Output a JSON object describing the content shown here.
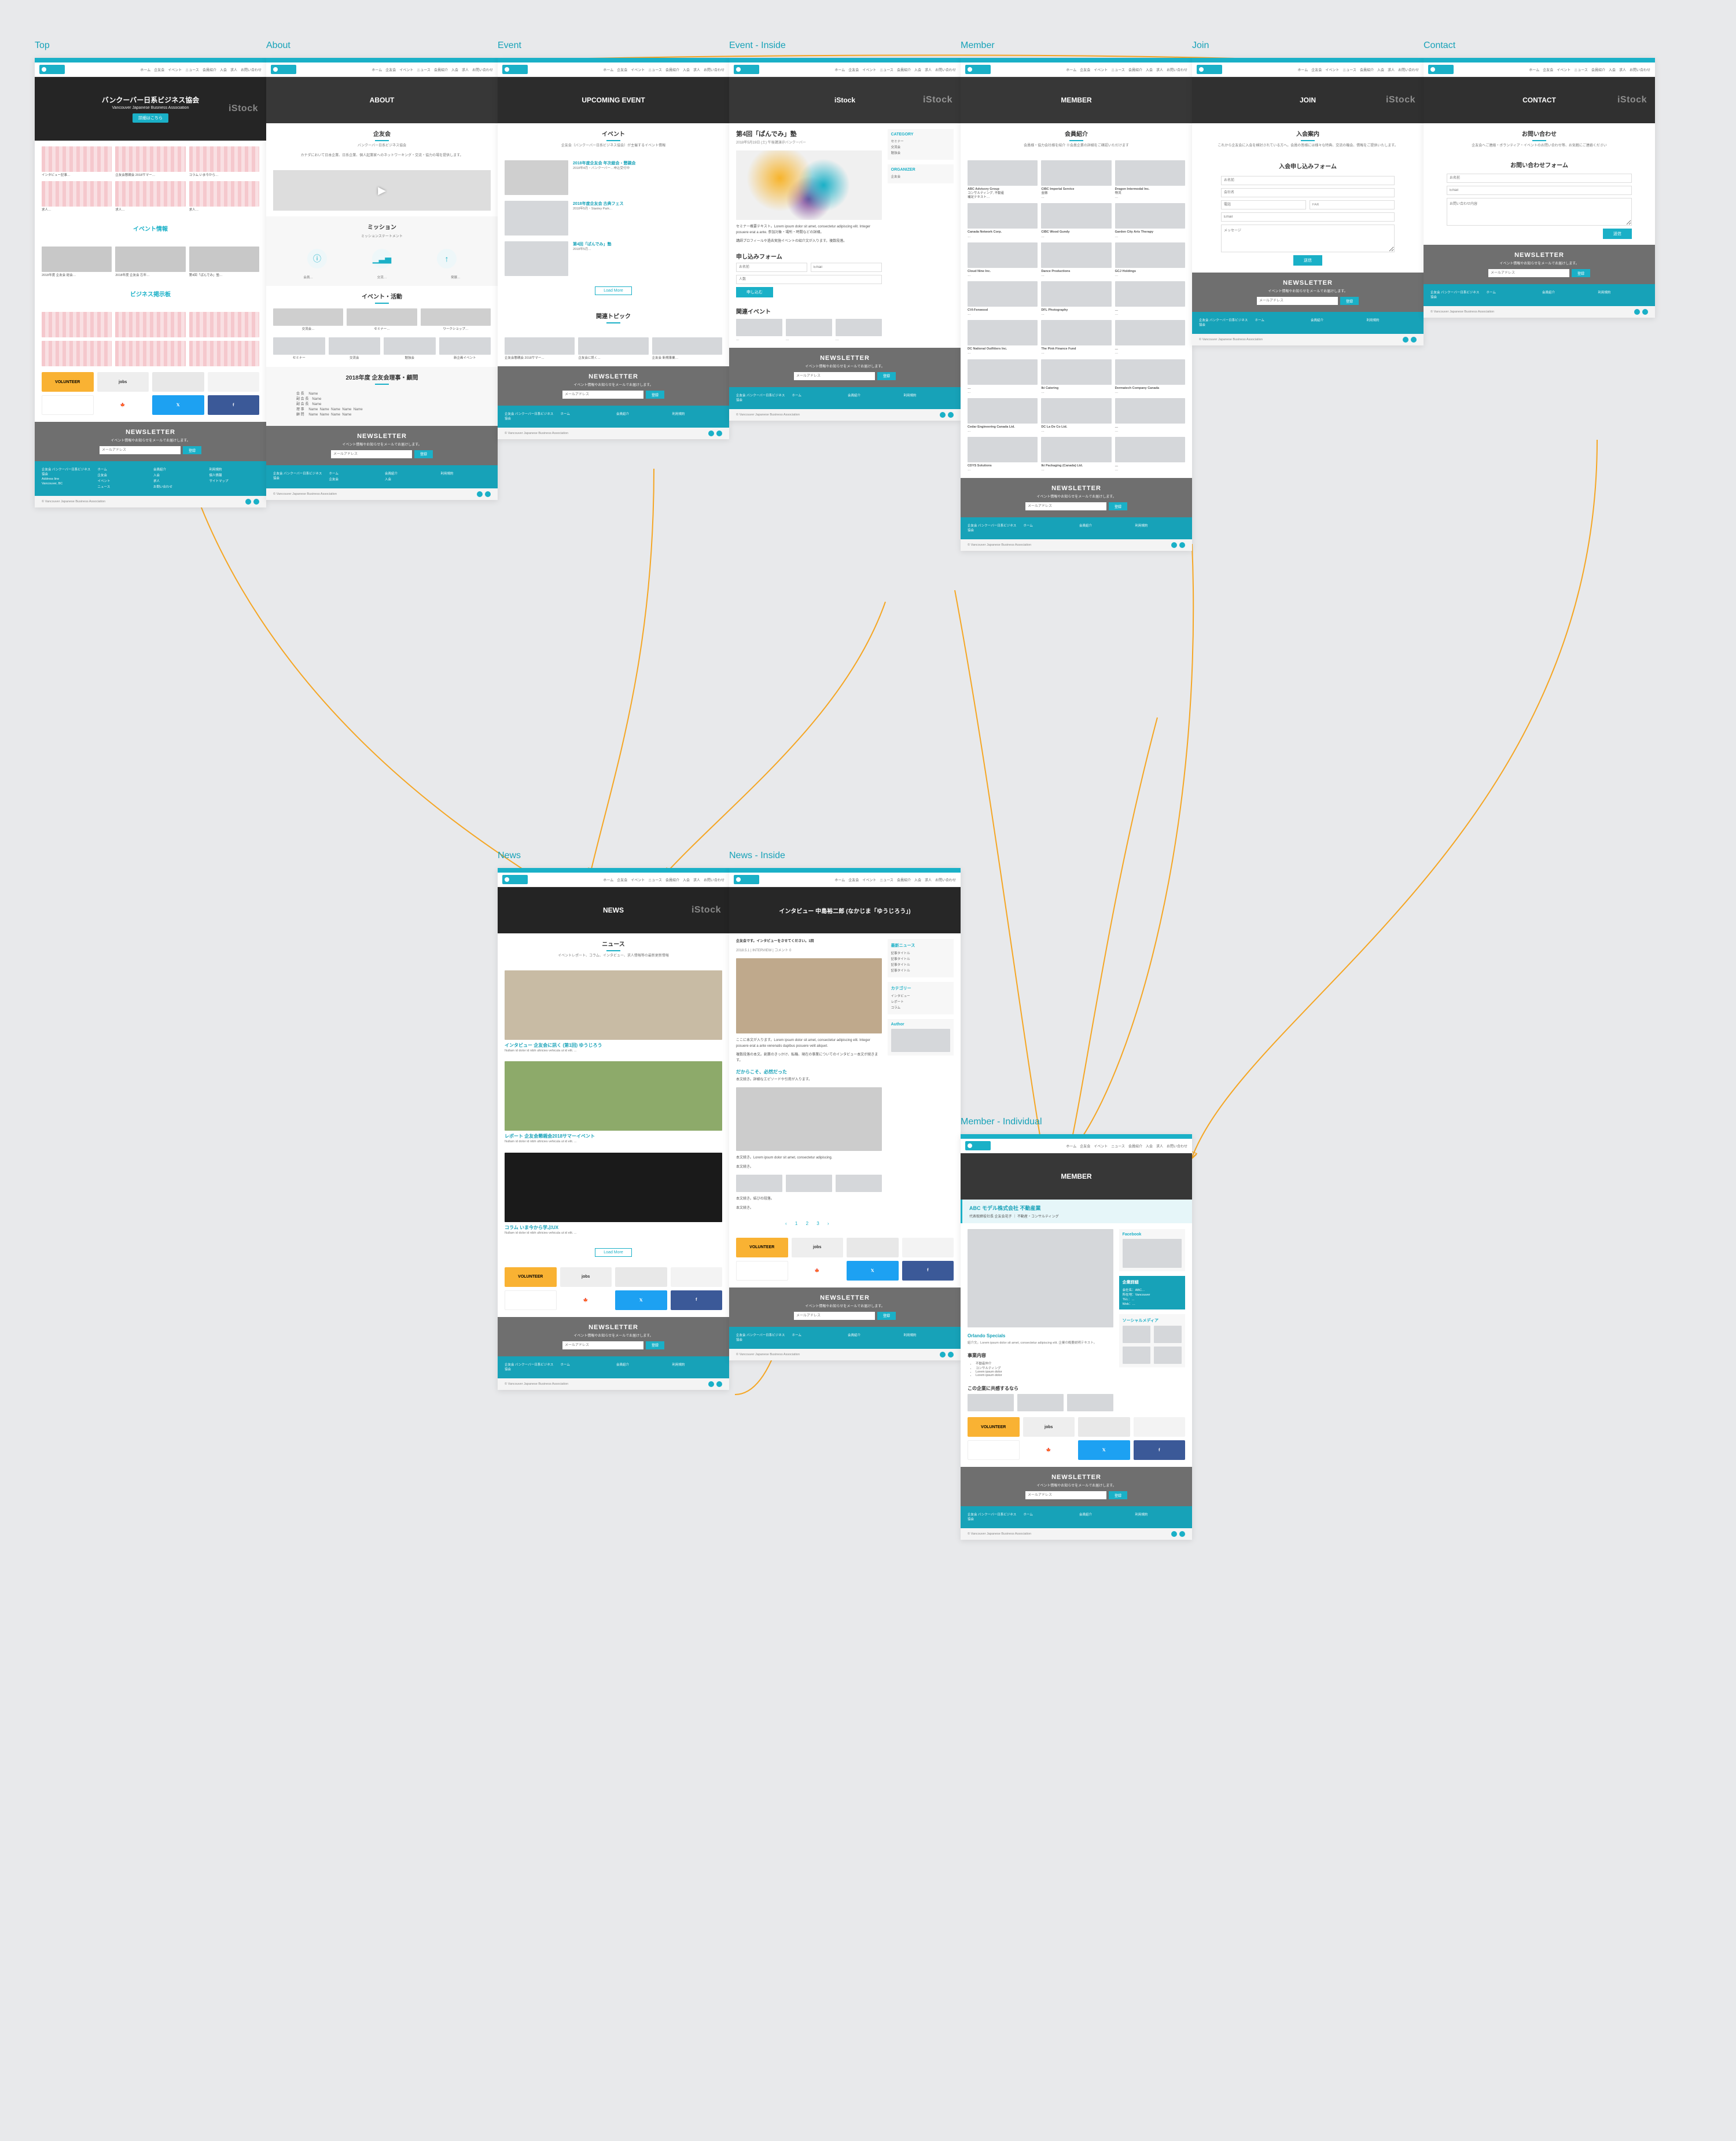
{
  "labels": {
    "top": "Top",
    "about": "About",
    "event": "Event",
    "event_inside": "Event - Inside",
    "member": "Member",
    "join": "Join",
    "contact": "Contact",
    "news": "News",
    "news_inside": "News - Inside",
    "member_individual": "Member - Individual"
  },
  "nav": {
    "items": [
      "ホーム",
      "企友会",
      "イベント",
      "ニュース",
      "会員紹介",
      "入会",
      "求人",
      "お問い合わせ"
    ]
  },
  "top": {
    "hero_title": "バンクーバー日系ビジネス協会",
    "hero_sub": "Vancouver Japanese Business Association",
    "hero_btn": "詳細はこちら",
    "sec_event": "イベント情報",
    "sec_biz": "ビジネス掲示板",
    "newsletter_title": "NEWSLETTER",
    "newsletter_text": "イベント情報やお知らせをメールでお届けします。",
    "newsletter_btn": "登録"
  },
  "about": {
    "hero": "ABOUT",
    "h1": "企友会",
    "tag": "バンクーバー日系ビジネス協会",
    "mission_h": "ミッション",
    "mission_sub": "ミッションステートメント",
    "activity_h": "イベント・活動",
    "board_h": "2018年度 企友会理事・顧問"
  },
  "event": {
    "hero": "UPCOMING EVENT",
    "h1": "イベント",
    "tag": "企友会（バンクーバー日系ビジネス協会）が主催するイベント情報",
    "related_h": "関連トピック",
    "loadmore": "Load More"
  },
  "event_inside": {
    "title": "第4回「ぱんでみ」塾",
    "date": "2018年5月19日 (土) 午後講演＠バンクーバー",
    "apply_h": "申し込みフォーム",
    "apply_btn": "申し込む",
    "side_related": "関連イベント",
    "side_cat": "CATEGORY",
    "side_org": "ORGANIZER"
  },
  "member": {
    "hero": "MEMBER",
    "h1": "会員紹介",
    "tag": "会員様・協力会社様を紹介 ※会員企業の詳細をご確認いただけます",
    "newsletter_title": "NEWSLETTER"
  },
  "join": {
    "hero": "JOIN",
    "h1": "入会案内",
    "form_h": "入会申し込みフォーム",
    "btn": "送信"
  },
  "contact": {
    "hero": "CONTACT",
    "h1": "お問い合わせ",
    "tag": "企友会へご連絡・ボランティア・イベントのお問い合わせ等、お気軽にご連絡ください",
    "form_h": "お問い合わせフォーム",
    "btn": "送信"
  },
  "news": {
    "hero": "NEWS",
    "h1": "ニュース",
    "tag": "イベントレポート、コラム、インタビュー、求人情報等の最新更新情報",
    "items": [
      {
        "title": "インタビュー 企友会に訊く (第1回) ゆうじろう",
        "desc": "Nullam id dolor id nibh ultricies vehicula ut id elit. ..."
      },
      {
        "title": "レポート 企友会懇親会2018サマーイベント",
        "desc": "Nullam id dolor id nibh ultricies vehicula ut id elit. ..."
      },
      {
        "title": "コラム いま今から学ぶUX",
        "desc": "Nullam id dolor id nibh ultricies vehicula ut id elit. ..."
      }
    ],
    "loadmore": "Load More"
  },
  "news_inside": {
    "hero_title": "インタビュー 中島裕二郎 (なかじま「ゆうじろう」)",
    "lead": "企友会です。インタビューをさせてください。1回",
    "side_new": "最新ニュース",
    "side_cat": "カテゴリー",
    "author": "Author"
  },
  "member_individual": {
    "hero": "MEMBER",
    "h1": "ABC モデル株式会社 不動産業",
    "sub": "代表取締役社長 企友会花子 ｜ 不動産・コンサルティング",
    "section_service": "事業内容",
    "section_detail": "企業詳細",
    "section_rec": "この企業に共感するなら",
    "social_h": "ソーシャルメディア"
  },
  "footer": {
    "col1": [
      "企友会 バンクーバー日系ビジネス協会",
      "Address line",
      "Vancouver, BC"
    ],
    "col2": [
      "ホーム",
      "企友会",
      "イベント",
      "ニュース"
    ],
    "col3": [
      "会員紹介",
      "入会",
      "求人",
      "お問い合わせ"
    ],
    "col4": [
      "利用規約",
      "個人情報",
      "サイトマップ"
    ],
    "copy": "© Vancouver Japanese Business Association"
  },
  "newsletter": {
    "title": "NEWSLETTER",
    "text": "イベント情報やお知らせをメールでお届けします。",
    "placeholder": "メールアドレス",
    "btn": "登録"
  }
}
